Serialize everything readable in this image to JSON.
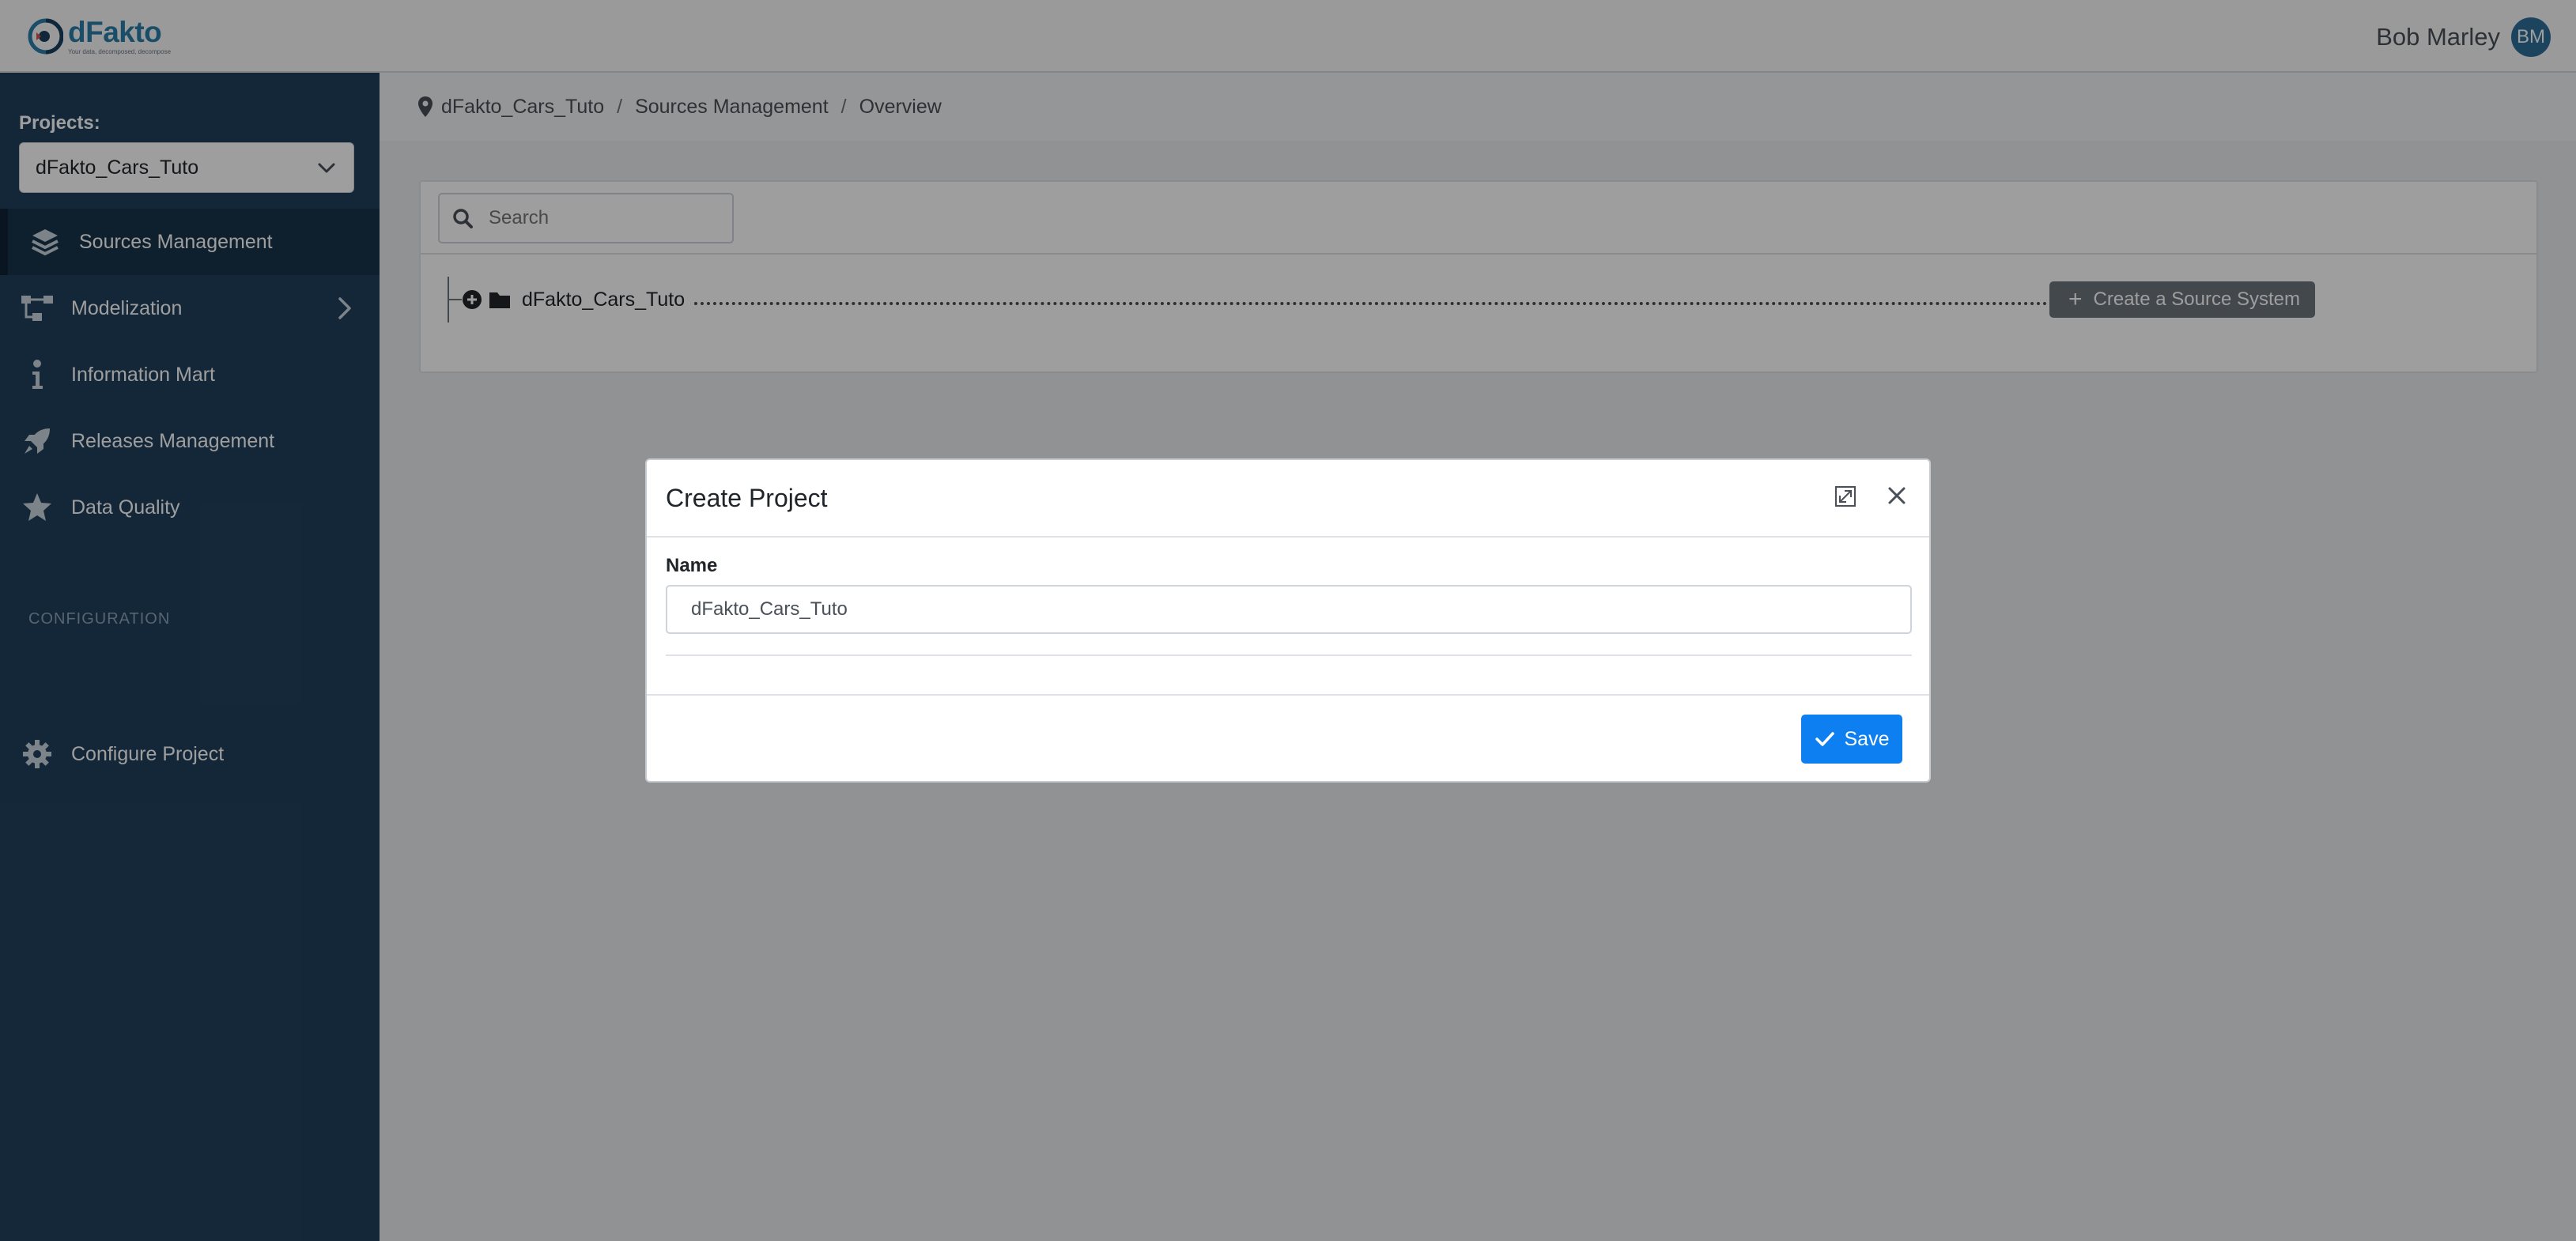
{
  "header": {
    "logo": {
      "name": "dFakto",
      "tagline": "Your data, decomposed, decompose"
    },
    "user": {
      "name": "Bob Marley",
      "initials": "BM"
    }
  },
  "sidebar": {
    "projects_label": "Projects:",
    "selected_project": "dFakto_Cars_Tuto",
    "items": [
      {
        "label": "Sources Management",
        "icon": "layers-icon",
        "active": true
      },
      {
        "label": "Modelization",
        "icon": "diagram-icon",
        "has_submenu": true
      },
      {
        "label": "Information Mart",
        "icon": "info-icon"
      },
      {
        "label": "Releases Management",
        "icon": "rocket-icon"
      },
      {
        "label": "Data Quality",
        "icon": "star-icon"
      }
    ],
    "section_label": "CONFIGURATION",
    "config_item": {
      "label": "Configure Project",
      "icon": "gear-icon"
    }
  },
  "breadcrumb": {
    "items": [
      "dFakto_Cars_Tuto",
      "Sources Management",
      "Overview"
    ],
    "separator": "/"
  },
  "main": {
    "search": {
      "placeholder": "Search",
      "value": ""
    },
    "tree": {
      "root_label": "dFakto_Cars_Tuto"
    },
    "create_source_button": "Create a Source System"
  },
  "modal": {
    "title": "Create Project",
    "name_label": "Name",
    "name_value": "dFakto_Cars_Tuto",
    "save_label": "Save"
  },
  "colors": {
    "sidebar_bg": "#21405c",
    "primary": "#0d7ff0",
    "secondary_button": "#6c757d",
    "avatar": "#2f6e99"
  }
}
